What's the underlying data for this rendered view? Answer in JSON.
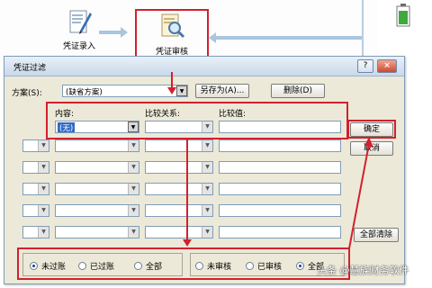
{
  "flow": {
    "entry_label": "凭证录入",
    "audit_label": "凭证审核"
  },
  "dialog": {
    "title": "凭证过滤",
    "help_label": "?",
    "close_label": "×",
    "scheme_label": "方案(S):",
    "scheme_value": "(缺省方案)",
    "save_as_label": "另存为(A)...",
    "delete_label": "删除(D)",
    "col_content": "内容:",
    "col_compare": "比较关系:",
    "col_value": "比较值:",
    "first_content_value": "(无)",
    "confirm_label": "确定",
    "cancel_label": "取消",
    "clear_all_label": "全部清除",
    "posting_options": [
      {
        "label": "未过账",
        "checked": true
      },
      {
        "label": "已过账",
        "checked": false
      },
      {
        "label": "全部",
        "checked": false
      }
    ],
    "audit_options": [
      {
        "label": "未审核",
        "checked": false
      },
      {
        "label": "已审核",
        "checked": false
      },
      {
        "label": "全部",
        "checked": true
      }
    ]
  },
  "watermark": "头条 @慧族财务软件",
  "colors": {
    "highlight_red": "#d2202e",
    "dialog_bg": "#ece9d8",
    "flow_arrow": "#a9c5df"
  }
}
